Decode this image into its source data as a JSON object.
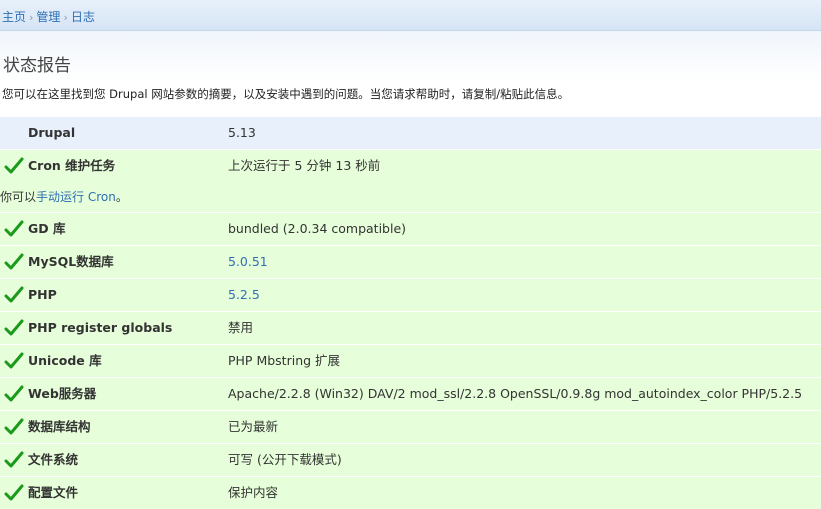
{
  "breadcrumb": {
    "home": "主页",
    "admin": "管理",
    "logs": "日志"
  },
  "page": {
    "title": "状态报告",
    "intro": "您可以在这里找到您 Drupal 网站参数的摘要，以及安装中遇到的问题。当您请求帮助时，请复制/粘贴此信息。"
  },
  "rows": [
    {
      "title": "Drupal",
      "value": "5.13",
      "status": "info"
    },
    {
      "title": "Cron 维护任务",
      "value": "上次运行于 5 分钟 13 秒前",
      "status": "ok",
      "description_prefix": "你可以",
      "description_link": "手动运行 Cron",
      "description_suffix": "。"
    },
    {
      "title": "GD 库",
      "value": "bundled (2.0.34 compatible)",
      "status": "ok"
    },
    {
      "title": "MySQL数据库",
      "value": "5.0.51",
      "status": "ok",
      "value_is_link": true
    },
    {
      "title": "PHP",
      "value": "5.2.5",
      "status": "ok",
      "value_is_link": true
    },
    {
      "title": "PHP register globals",
      "value": "禁用",
      "status": "ok"
    },
    {
      "title": "Unicode 库",
      "value": "PHP Mbstring 扩展",
      "status": "ok"
    },
    {
      "title": "Web服务器",
      "value": "Apache/2.2.8 (Win32) DAV/2 mod_ssl/2.2.8 OpenSSL/0.9.8g mod_autoindex_color PHP/5.2.5",
      "status": "ok"
    },
    {
      "title": "数据库结构",
      "value": "已为最新",
      "status": "ok"
    },
    {
      "title": "文件系统",
      "value": "可写 (公开下载模式)",
      "status": "ok"
    },
    {
      "title": "配置文件",
      "value": "保护内容",
      "status": "ok"
    }
  ],
  "icons": {
    "ok_icon": "check-icon",
    "check_color": "#1a9a1a"
  }
}
